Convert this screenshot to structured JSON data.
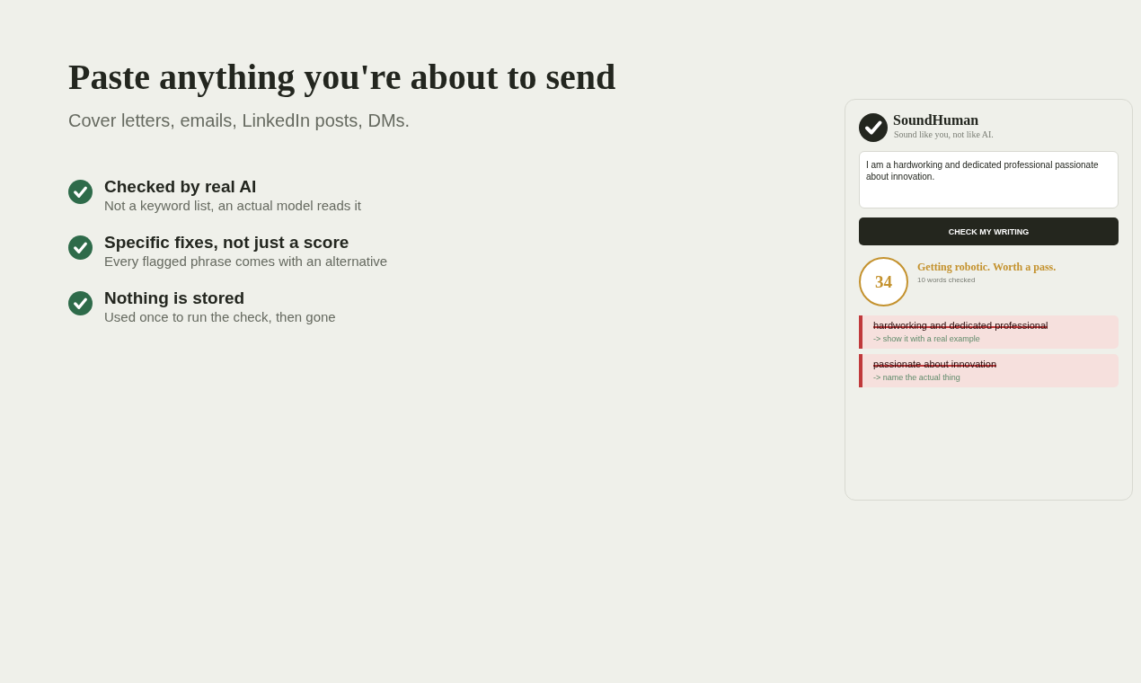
{
  "hero": {
    "title": "Paste anything you're about to send",
    "subtitle": "Cover letters, emails, LinkedIn posts, DMs."
  },
  "features": [
    {
      "title": "Checked by real AI",
      "description": "Not a keyword list, an actual model reads it"
    },
    {
      "title": "Specific fixes, not just a score",
      "description": "Every flagged phrase comes with an alternative"
    },
    {
      "title": "Nothing is stored",
      "description": "Used once to run the check, then gone"
    }
  ],
  "card": {
    "brand": {
      "name": "SoundHuman",
      "tagline": "Sound like you, not like AI."
    },
    "input": {
      "value": "I am a hardworking and dedicated professional passionate about innovation."
    },
    "button": "CHECK MY WRITING",
    "result": {
      "score": "34",
      "verdict": "Getting robotic. Worth a pass.",
      "meta": "10 words checked"
    },
    "flags": [
      {
        "phrase": "hardworking and dedicated professional",
        "suggestion": "-> show it with a real example"
      },
      {
        "phrase": "passionate about innovation",
        "suggestion": "-> name the actual thing"
      }
    ]
  }
}
